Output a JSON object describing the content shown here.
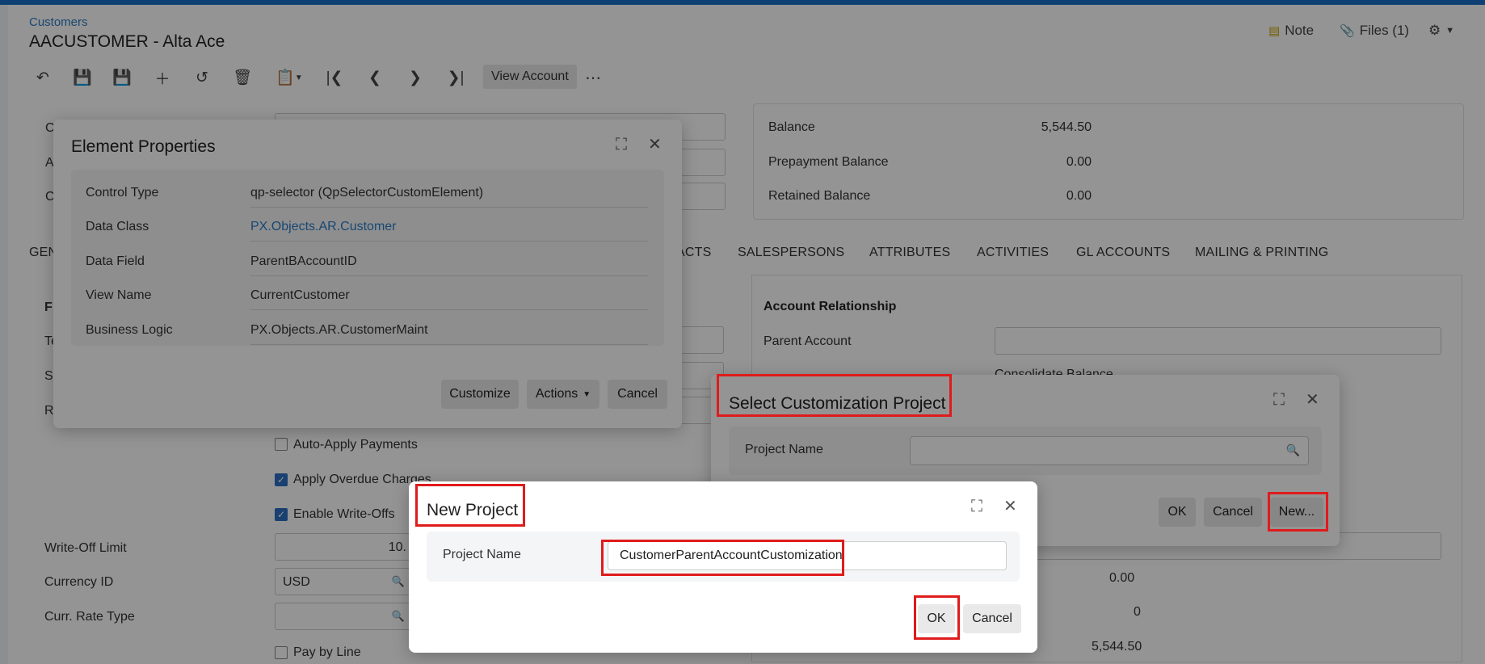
{
  "header": {
    "breadcrumb": "Customers",
    "title": "AACUSTOMER - Alta Ace",
    "note_label": "Note",
    "files_label": "Files (1)"
  },
  "toolbar": {
    "view_account_label": "View Account",
    "more_label": "⋯"
  },
  "summary": {
    "rows": [
      {
        "label": "Balance",
        "value": "5,544.50"
      },
      {
        "label": "Prepayment Balance",
        "value": "0.00"
      },
      {
        "label": "Retained Balance",
        "value": "0.00"
      }
    ]
  },
  "tabs": [
    "GEN",
    "ACTS",
    "SALESPERSONS",
    "ATTRIBUTES",
    "ACTIVITIES",
    "GL ACCOUNTS",
    "MAILING & PRINTING"
  ],
  "form": {
    "section_letter": "F",
    "side_letters": [
      "C",
      "A",
      "C",
      "Te",
      "S",
      "R"
    ],
    "auto_apply_label": "Auto-Apply Payments",
    "apply_overdue_label": "Apply Overdue Charges",
    "enable_writeoffs_label": "Enable Write-Offs",
    "writeoff_limit_label": "Write-Off Limit",
    "writeoff_limit_value": "10.",
    "currency_id_label": "Currency ID",
    "currency_id_value": "USD",
    "curr_rate_type_label": "Curr. Rate Type",
    "pay_by_line_label": "Pay by Line"
  },
  "account_relationship": {
    "heading": "Account Relationship",
    "parent_account_label": "Parent Account",
    "consolidate_label": "Consolidate Balance",
    "values": [
      "0.00",
      "0",
      "5,544.50"
    ]
  },
  "element_properties": {
    "title": "Element Properties",
    "rows": [
      {
        "label": "Control Type",
        "value": "qp-selector (QpSelectorCustomElement)"
      },
      {
        "label": "Data Class",
        "value": "PX.Objects.AR.Customer"
      },
      {
        "label": "Data Field",
        "value": "ParentBAccountID"
      },
      {
        "label": "View Name",
        "value": "CurrentCustomer"
      },
      {
        "label": "Business Logic",
        "value": "PX.Objects.AR.CustomerMaint"
      }
    ],
    "customize_label": "Customize",
    "actions_label": "Actions",
    "cancel_label": "Cancel"
  },
  "select_project": {
    "title": "Select Customization Project",
    "project_name_label": "Project Name",
    "project_name_value": "",
    "ok_label": "OK",
    "cancel_label": "Cancel",
    "new_label": "New..."
  },
  "new_project": {
    "title": "New Project",
    "project_name_label": "Project Name",
    "project_name_value": "CustomerParentAccountCustomization",
    "ok_label": "OK",
    "cancel_label": "Cancel"
  },
  "colors": {
    "accent": "#1a6fc9",
    "link": "#2b7bc4",
    "highlight": "#e01b1b"
  }
}
